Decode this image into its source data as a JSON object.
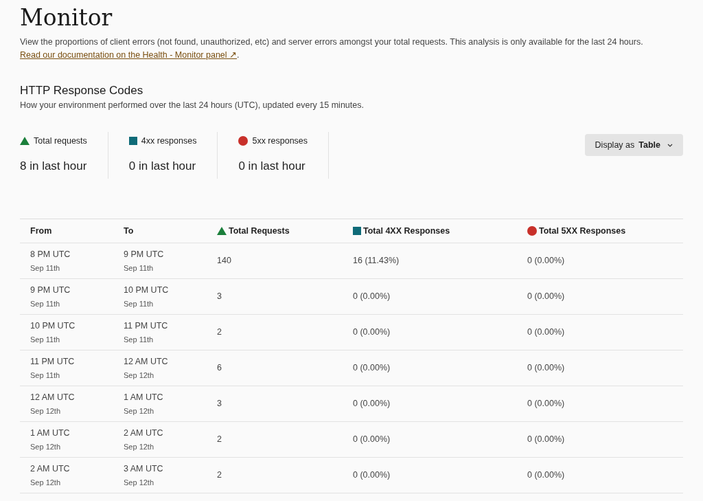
{
  "page": {
    "title": "Monitor",
    "description": "View the proportions of client errors (not found, unauthorized, etc) and server errors amongst your total requests. This analysis is only available for the last 24 hours.",
    "doc_link": "Read our documentation on the Health - Monitor panel ↗",
    "doc_link_suffix": "."
  },
  "section": {
    "title": "HTTP Response Codes",
    "subtitle": "How your environment performed over the last 24 hours (UTC), updated every 15 minutes."
  },
  "stats": [
    {
      "kind": "triangle",
      "color": "#1b7f3b",
      "label": "Total requests",
      "value": "8 in last hour"
    },
    {
      "kind": "square",
      "color": "#0f6b78",
      "label": "4xx responses",
      "value": "0 in last hour"
    },
    {
      "kind": "circle",
      "color": "#c8302a",
      "label": "5xx responses",
      "value": "0 in last hour"
    }
  ],
  "display_select": {
    "label": "Display as",
    "value": "Table"
  },
  "table": {
    "columns": [
      {
        "label": "From"
      },
      {
        "label": "To"
      },
      {
        "label": "Total Requests",
        "kind": "triangle",
        "color": "#1b7f3b"
      },
      {
        "label": "Total 4XX Responses",
        "kind": "square",
        "color": "#0f6b78"
      },
      {
        "label": "Total 5XX Responses",
        "kind": "circle",
        "color": "#c8302a"
      }
    ],
    "rows": [
      {
        "from": "8 PM UTC",
        "from_date": "Sep 11th",
        "to": "9 PM UTC",
        "to_date": "Sep 11th",
        "total": "140",
        "r4xx": "16 (11.43%)",
        "r5xx": "0 (0.00%)"
      },
      {
        "from": "9 PM UTC",
        "from_date": "Sep 11th",
        "to": "10 PM UTC",
        "to_date": "Sep 11th",
        "total": "3",
        "r4xx": "0 (0.00%)",
        "r5xx": "0 (0.00%)"
      },
      {
        "from": "10 PM UTC",
        "from_date": "Sep 11th",
        "to": "11 PM UTC",
        "to_date": "Sep 11th",
        "total": "2",
        "r4xx": "0 (0.00%)",
        "r5xx": "0 (0.00%)"
      },
      {
        "from": "11 PM UTC",
        "from_date": "Sep 11th",
        "to": "12 AM UTC",
        "to_date": "Sep 12th",
        "total": "6",
        "r4xx": "0 (0.00%)",
        "r5xx": "0 (0.00%)"
      },
      {
        "from": "12 AM UTC",
        "from_date": "Sep 12th",
        "to": "1 AM UTC",
        "to_date": "Sep 12th",
        "total": "3",
        "r4xx": "0 (0.00%)",
        "r5xx": "0 (0.00%)"
      },
      {
        "from": "1 AM UTC",
        "from_date": "Sep 12th",
        "to": "2 AM UTC",
        "to_date": "Sep 12th",
        "total": "2",
        "r4xx": "0 (0.00%)",
        "r5xx": "0 (0.00%)"
      },
      {
        "from": "2 AM UTC",
        "from_date": "Sep 12th",
        "to": "3 AM UTC",
        "to_date": "Sep 12th",
        "total": "2",
        "r4xx": "0 (0.00%)",
        "r5xx": "0 (0.00%)"
      }
    ]
  }
}
